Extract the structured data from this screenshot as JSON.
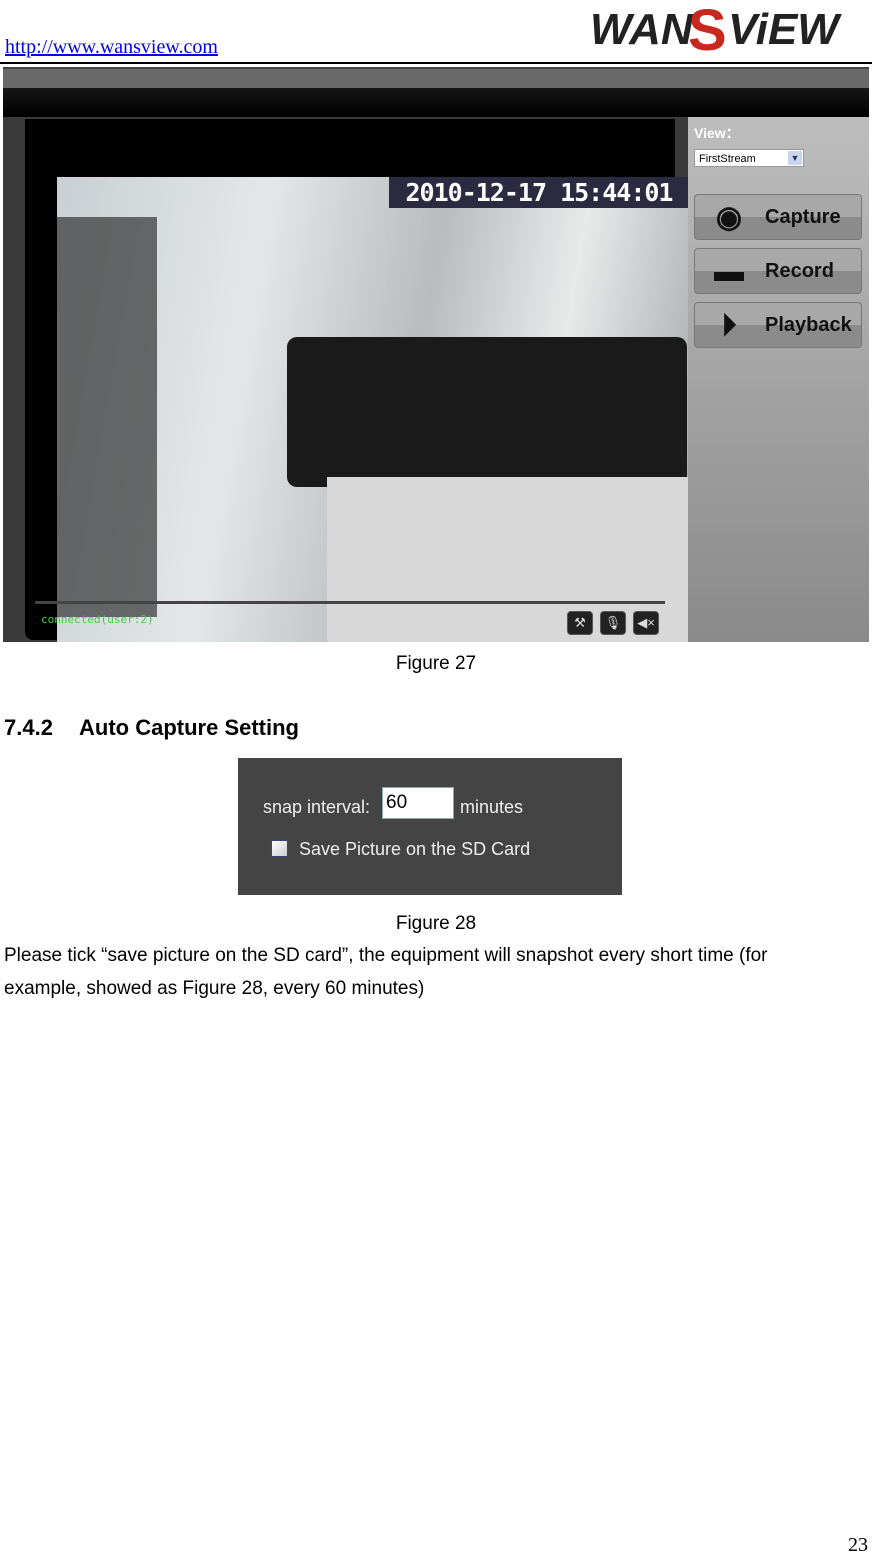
{
  "header": {
    "url": "http://www.wansview.com",
    "logo_text": "WANSVIEW"
  },
  "figure27": {
    "timestamp": "2010-12-17 15:44:01",
    "status": "connected(user:2)",
    "view_label": "View：",
    "stream_selected": "FirstStream",
    "buttons": {
      "capture": "Capture",
      "record": "Record",
      "playback": "Playback"
    },
    "caption": "Figure 27"
  },
  "section": {
    "number": "7.4.2",
    "title": "Auto Capture Setting"
  },
  "figure28": {
    "snap_label": "snap interval:",
    "snap_value": "60",
    "unit": "minutes",
    "checkbox_label": "Save Picture on the SD Card",
    "checkbox_checked": false,
    "caption": "Figure 28"
  },
  "body": {
    "line1": "Please tick “save picture on the SD card”, the equipment will snapshot every short time (for",
    "line2": "example, showed as Figure 28, every 60 minutes)"
  },
  "page_number": "23",
  "colors": {
    "logo_red": "#c8281e",
    "status_green": "#3fd03f",
    "link": "#0000ee"
  }
}
